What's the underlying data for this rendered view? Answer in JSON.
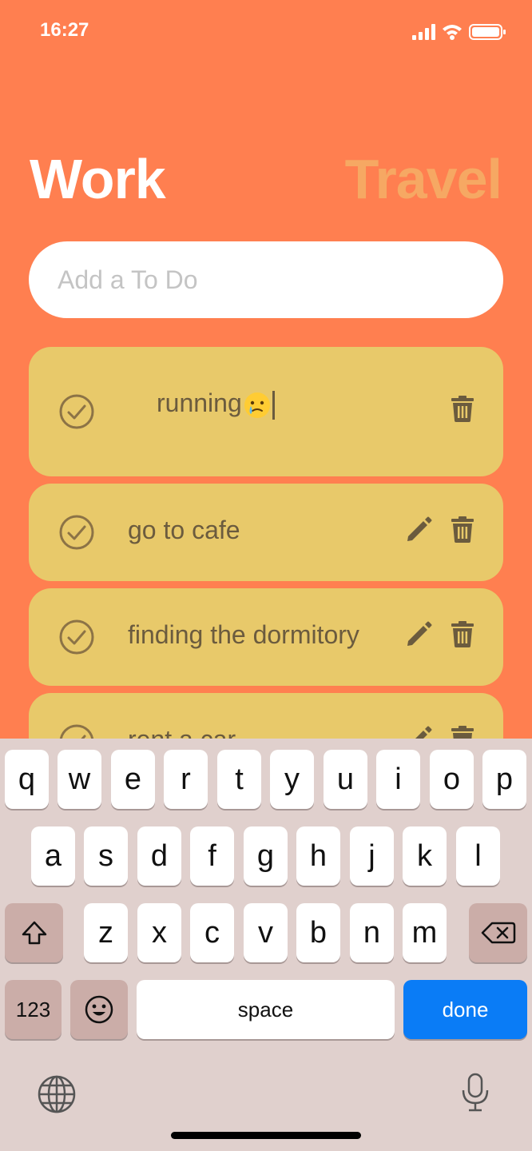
{
  "status": {
    "time": "16:27"
  },
  "header": {
    "tab_work": "Work",
    "tab_travel": "Travel"
  },
  "add_todo": {
    "placeholder": "Add a To Do",
    "value": ""
  },
  "todos": [
    {
      "text": "running",
      "editing": true
    },
    {
      "text": "go to cafe",
      "editing": false
    },
    {
      "text": "finding the dormitory",
      "editing": false
    },
    {
      "text": "rent a car",
      "editing": false
    }
  ],
  "keyboard": {
    "row1": [
      "q",
      "w",
      "e",
      "r",
      "t",
      "y",
      "u",
      "i",
      "o",
      "p"
    ],
    "row2": [
      "a",
      "s",
      "d",
      "f",
      "g",
      "h",
      "j",
      "k",
      "l"
    ],
    "row3": [
      "z",
      "x",
      "c",
      "v",
      "b",
      "n",
      "m"
    ],
    "numbers_label": "123",
    "space_label": "space",
    "done_label": "done"
  },
  "colors": {
    "background": "#FF7F50",
    "card": "#E8C96A",
    "accent_done": "#0A7CF6",
    "inactive_tab": "#F6A863"
  },
  "icons": [
    "check-circle-icon",
    "pencil-icon",
    "trash-icon",
    "shift-icon",
    "backspace-icon",
    "emoji-icon",
    "globe-icon",
    "microphone-icon"
  ]
}
